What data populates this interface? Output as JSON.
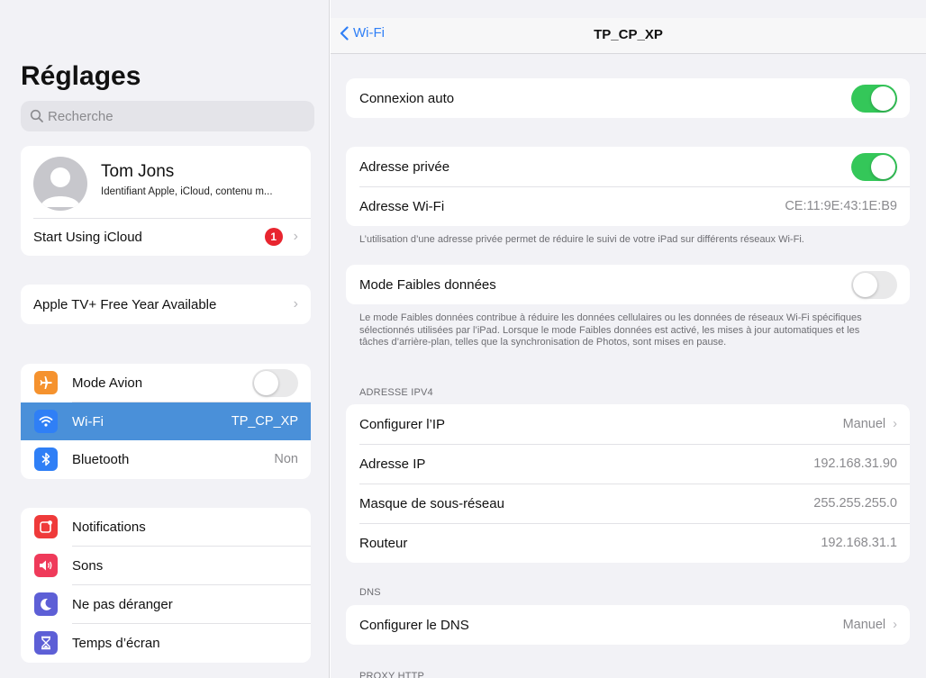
{
  "sidebar": {
    "title": "Réglages",
    "search_placeholder": "Recherche",
    "profile": {
      "name": "Tom Jons",
      "subtitle": "Identifiant Apple, iCloud, contenu m...",
      "icloud_label": "Start Using iCloud",
      "icloud_badge": "1"
    },
    "promo_label": "Apple TV+ Free Year Available",
    "group1": [
      {
        "label": "Mode Avion",
        "icon": "airplane-icon",
        "icon_color": "#f5922e",
        "toggle": "off"
      },
      {
        "label": "Wi-Fi",
        "icon": "wifi-icon",
        "icon_color": "#2f7ff6",
        "value": "TP_CP_XP",
        "selected": true
      },
      {
        "label": "Bluetooth",
        "icon": "bluetooth-icon",
        "icon_color": "#2f7ff6",
        "value": "Non"
      }
    ],
    "group2": [
      {
        "label": "Notifications",
        "icon": "notifications-icon",
        "icon_color": "#ef3a3a"
      },
      {
        "label": "Sons",
        "icon": "sounds-icon",
        "icon_color": "#ef3a5a"
      },
      {
        "label": "Ne pas déranger",
        "icon": "moon-icon",
        "icon_color": "#5d5fd6"
      },
      {
        "label": "Temps d’écran",
        "icon": "hourglass-icon",
        "icon_color": "#5d5fd6"
      }
    ]
  },
  "detail": {
    "back_label": "Wi-Fi",
    "title": "TP_CP_XP",
    "auto_join": {
      "label": "Connexion auto",
      "toggle": "on"
    },
    "private_address": {
      "label": "Adresse privée",
      "toggle": "on"
    },
    "wifi_address": {
      "label": "Adresse Wi-Fi",
      "value": "CE:11:9E:43:1E:B9"
    },
    "private_note": "L’utilisation d’une adresse privée permet de réduire le suivi de votre iPad sur différents réseaux Wi-Fi.",
    "low_data": {
      "label": "Mode Faibles données",
      "toggle": "off"
    },
    "low_data_note": "Le mode Faibles données contribue à réduire les données cellulaires ou les données de réseaux Wi-Fi spécifiques sélectionnés utilisées par l’iPad. Lorsque le mode Faibles données est activé, les mises à jour automatiques et les tâches d’arrière-plan, telles que la synchronisation de Photos, sont mises en pause.",
    "ipv4_header": "ADRESSE IPV4",
    "ipv4": [
      {
        "label": "Configurer l’IP",
        "value": "Manuel",
        "chevron": true
      },
      {
        "label": "Adresse IP",
        "value": "192.168.31.90"
      },
      {
        "label": "Masque de sous-réseau",
        "value": "255.255.255.0"
      },
      {
        "label": "Routeur",
        "value": "192.168.31.1"
      }
    ],
    "dns_header": "DNS",
    "dns": {
      "label": "Configurer le DNS",
      "value": "Manuel"
    },
    "proxy_header": "PROXY HTTP"
  },
  "colors": {
    "accent": "#2f7ff6",
    "toggle_on": "#34c759",
    "badge": "#e8252f",
    "selected_row": "#4a90d9"
  }
}
